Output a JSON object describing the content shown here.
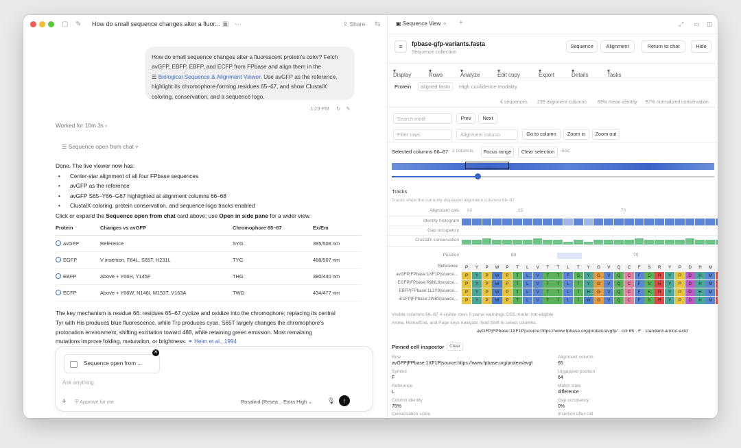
{
  "chat": {
    "title": "How do small sequence changes alter a fluor...",
    "share": "Share",
    "user_message_1": "How do small sequence changes alter a fluorescent protein's color? Fetch",
    "user_message_2": "avGFP, EBFP, EBFP, and ECFP from FPbase and align them in the",
    "user_message_link": "Biological Sequence & Alignment Viewer",
    "user_message_3": ". Use avGFP as the reference,",
    "user_message_4": "highlight its chromophore-forming residues 65–67, and show ClustalX",
    "user_message_5": "coloring, conservation, and a sequence logo.",
    "time": "1:23 PM",
    "worked": "Worked for 10m 3s",
    "sequence_open_chip": "Sequence open from chat",
    "done": "Done. The live viewer now has:",
    "bullets": [
      "Center-star alignment of all four FPbase sequences",
      "avGFP as the reference",
      "avGFP S65–Y66–G67 highlighted at alignment columns 66–68",
      "ClustalX coloring, protein conservation, and sequence-logo tracks enabled"
    ],
    "click_text_1": "Click or expand the ",
    "click_bold_1": "Sequence open from chat",
    "click_text_2": " card above; use ",
    "click_bold_2": "Open in side pane",
    "click_text_3": " for a wider view.",
    "table": {
      "headers": [
        "Protein",
        "Changes vs avGFP",
        "Chromophore 65–67",
        "Ex/Em"
      ],
      "rows": [
        [
          "avGFP",
          "Reference",
          "SYG",
          "395/508 nm"
        ],
        [
          "EGFP",
          "V insertion, F64L, S65T, H231L",
          "TYG",
          "488/507 nm"
        ],
        [
          "EBFP",
          "Above + Y66H, Y145F",
          "THG",
          "380/440 nm"
        ],
        [
          "ECFP",
          "Above + Y66W, N146I, M153T, V163A",
          "TWG",
          "434/477 nm"
        ]
      ]
    },
    "para_1": "The key mechanism is residue 66: residues 65–67 cyclize and oxidize into the chromophore; replacing its central",
    "para_2": "Tyr with His produces blue fluorescence, while Trp produces cyan. S65T largely changes the chromophore's",
    "para_3": "protonation environment, shifting excitation toward 488",
    "para_3b": ", while retaining green emission. Most remaining",
    "para_4": "mutations improve folding, maturation, or brightness.",
    "citation": "Heim et al., 1994",
    "composer": {
      "chip_label": "Sequence open from ...",
      "placeholder": "Ask anything",
      "approve": "Approve for me",
      "model": "Rosalind (Resea...  Extra High"
    }
  },
  "viewer": {
    "tab_label": "Sequence View",
    "file_title": "fpbase-gfp-variants.fasta",
    "file_subtitle": "Sequence collection",
    "buttons": [
      "Sequence",
      "Alignment",
      "Return to chat",
      "Hide"
    ],
    "menu": [
      "Display",
      "Rows",
      "Analyze",
      "Edit copy",
      "Export",
      "Details",
      "Tasks"
    ],
    "protein_tabs": [
      "Protein",
      "aligned fasta",
      "High confidence modality"
    ],
    "stats": [
      "4 sequences",
      "239 alignment columns",
      "89% mean identity",
      "87% normalized conservation"
    ],
    "search_placeholder": "Search motif",
    "prev": "Prev",
    "next": "Next",
    "filter_placeholder": "Filter rows",
    "alignment_placeholder": "Alignment column",
    "goto_column": "Go to column",
    "zoom_in": "Zoom in",
    "zoom_out": "Zoom out",
    "selected_label": "Selected columns 66–67",
    "selected_count": "2 columns",
    "focus_range": "Focus range",
    "clear_selection": "Clear selection",
    "esc": "Esc",
    "tracks_heading": "Tracks",
    "tracks_desc": "Tracks show the currently displayed alignment columns 66–87",
    "track_labels": [
      "Alignment cols",
      "Identity histogram",
      "Gap occupancy",
      "ClustalX conservation"
    ],
    "ruler_ticks": [
      "60",
      "65",
      "70"
    ],
    "position_label": "Position",
    "seq_labels": [
      "Reference",
      "avGFP|FPbase:1XF1P|source...",
      "EGFP|FPbase:R9NL8|source...",
      "EBFP|FPbase:1L2Y9|source...",
      "ECFP|FPbase:2W8S|source..."
    ],
    "ref_residues": "PYPWPTLVTTLTYGVQCFSRYPDHMK",
    "row_residues": [
      "PYPWPTLVTTFSYGVQCFSRYPDHMK",
      "PYPWPTLVTTLTYGVQCFSRYPDHMK",
      "PYPWPTLVTTLTHGVQCFSRYPDHMK",
      "PYPWPTLVTTLTWGVQCFSRYPDHMK"
    ],
    "residue_colors": {
      "P": "#e8c23a",
      "Y": "#4aa89a",
      "W": "#4d7fd1",
      "T": "#59b359",
      "L": "#5a86d6",
      "V": "#5a86d6",
      "F": "#5a86d6",
      "S": "#59b359",
      "G": "#e89b3c",
      "Q": "#59b359",
      "C": "#e37fa0",
      "R": "#e04848",
      "D": "#c059c8",
      "H": "#4aa89a",
      "M": "#5a86d6",
      "K": "#e04848"
    },
    "visible_info": "Visible columns 66–87    4 visible rows    0 parse warnings    CSS mode: not-eligible",
    "help": "Arrow, Home/End, and Page keys navigate; hold Shift to select columns.",
    "hover_info": "avGFP|FPbase:1XF1P|source:https://www.fpbase.org/protein/avgfp/ · col 65 · F · standard-amino-acid",
    "pinned_heading": "Pinned cell inspector",
    "pinned_clear": "Clear",
    "pinned": {
      "row_label": "Row",
      "row_value": "avGFP|FPbase:1XF1P|source:https://www.fpbase.org/protein/avgf",
      "col_label": "Alignment column",
      "col_value": "65",
      "symbol_label": "Symbol",
      "symbol_value": "F",
      "ungapped_label": "Ungapped position",
      "ungapped_value": "64",
      "reference_label": "Reference",
      "reference_value": "L",
      "match_label": "Match state",
      "match_value": "difference",
      "identity_label": "Column identity",
      "identity_value": "75%",
      "gap_label": "Gap occupancy",
      "gap_value": "0%",
      "conservation_label": "Conservation score",
      "insertion_label": "Insertion after cell"
    }
  }
}
